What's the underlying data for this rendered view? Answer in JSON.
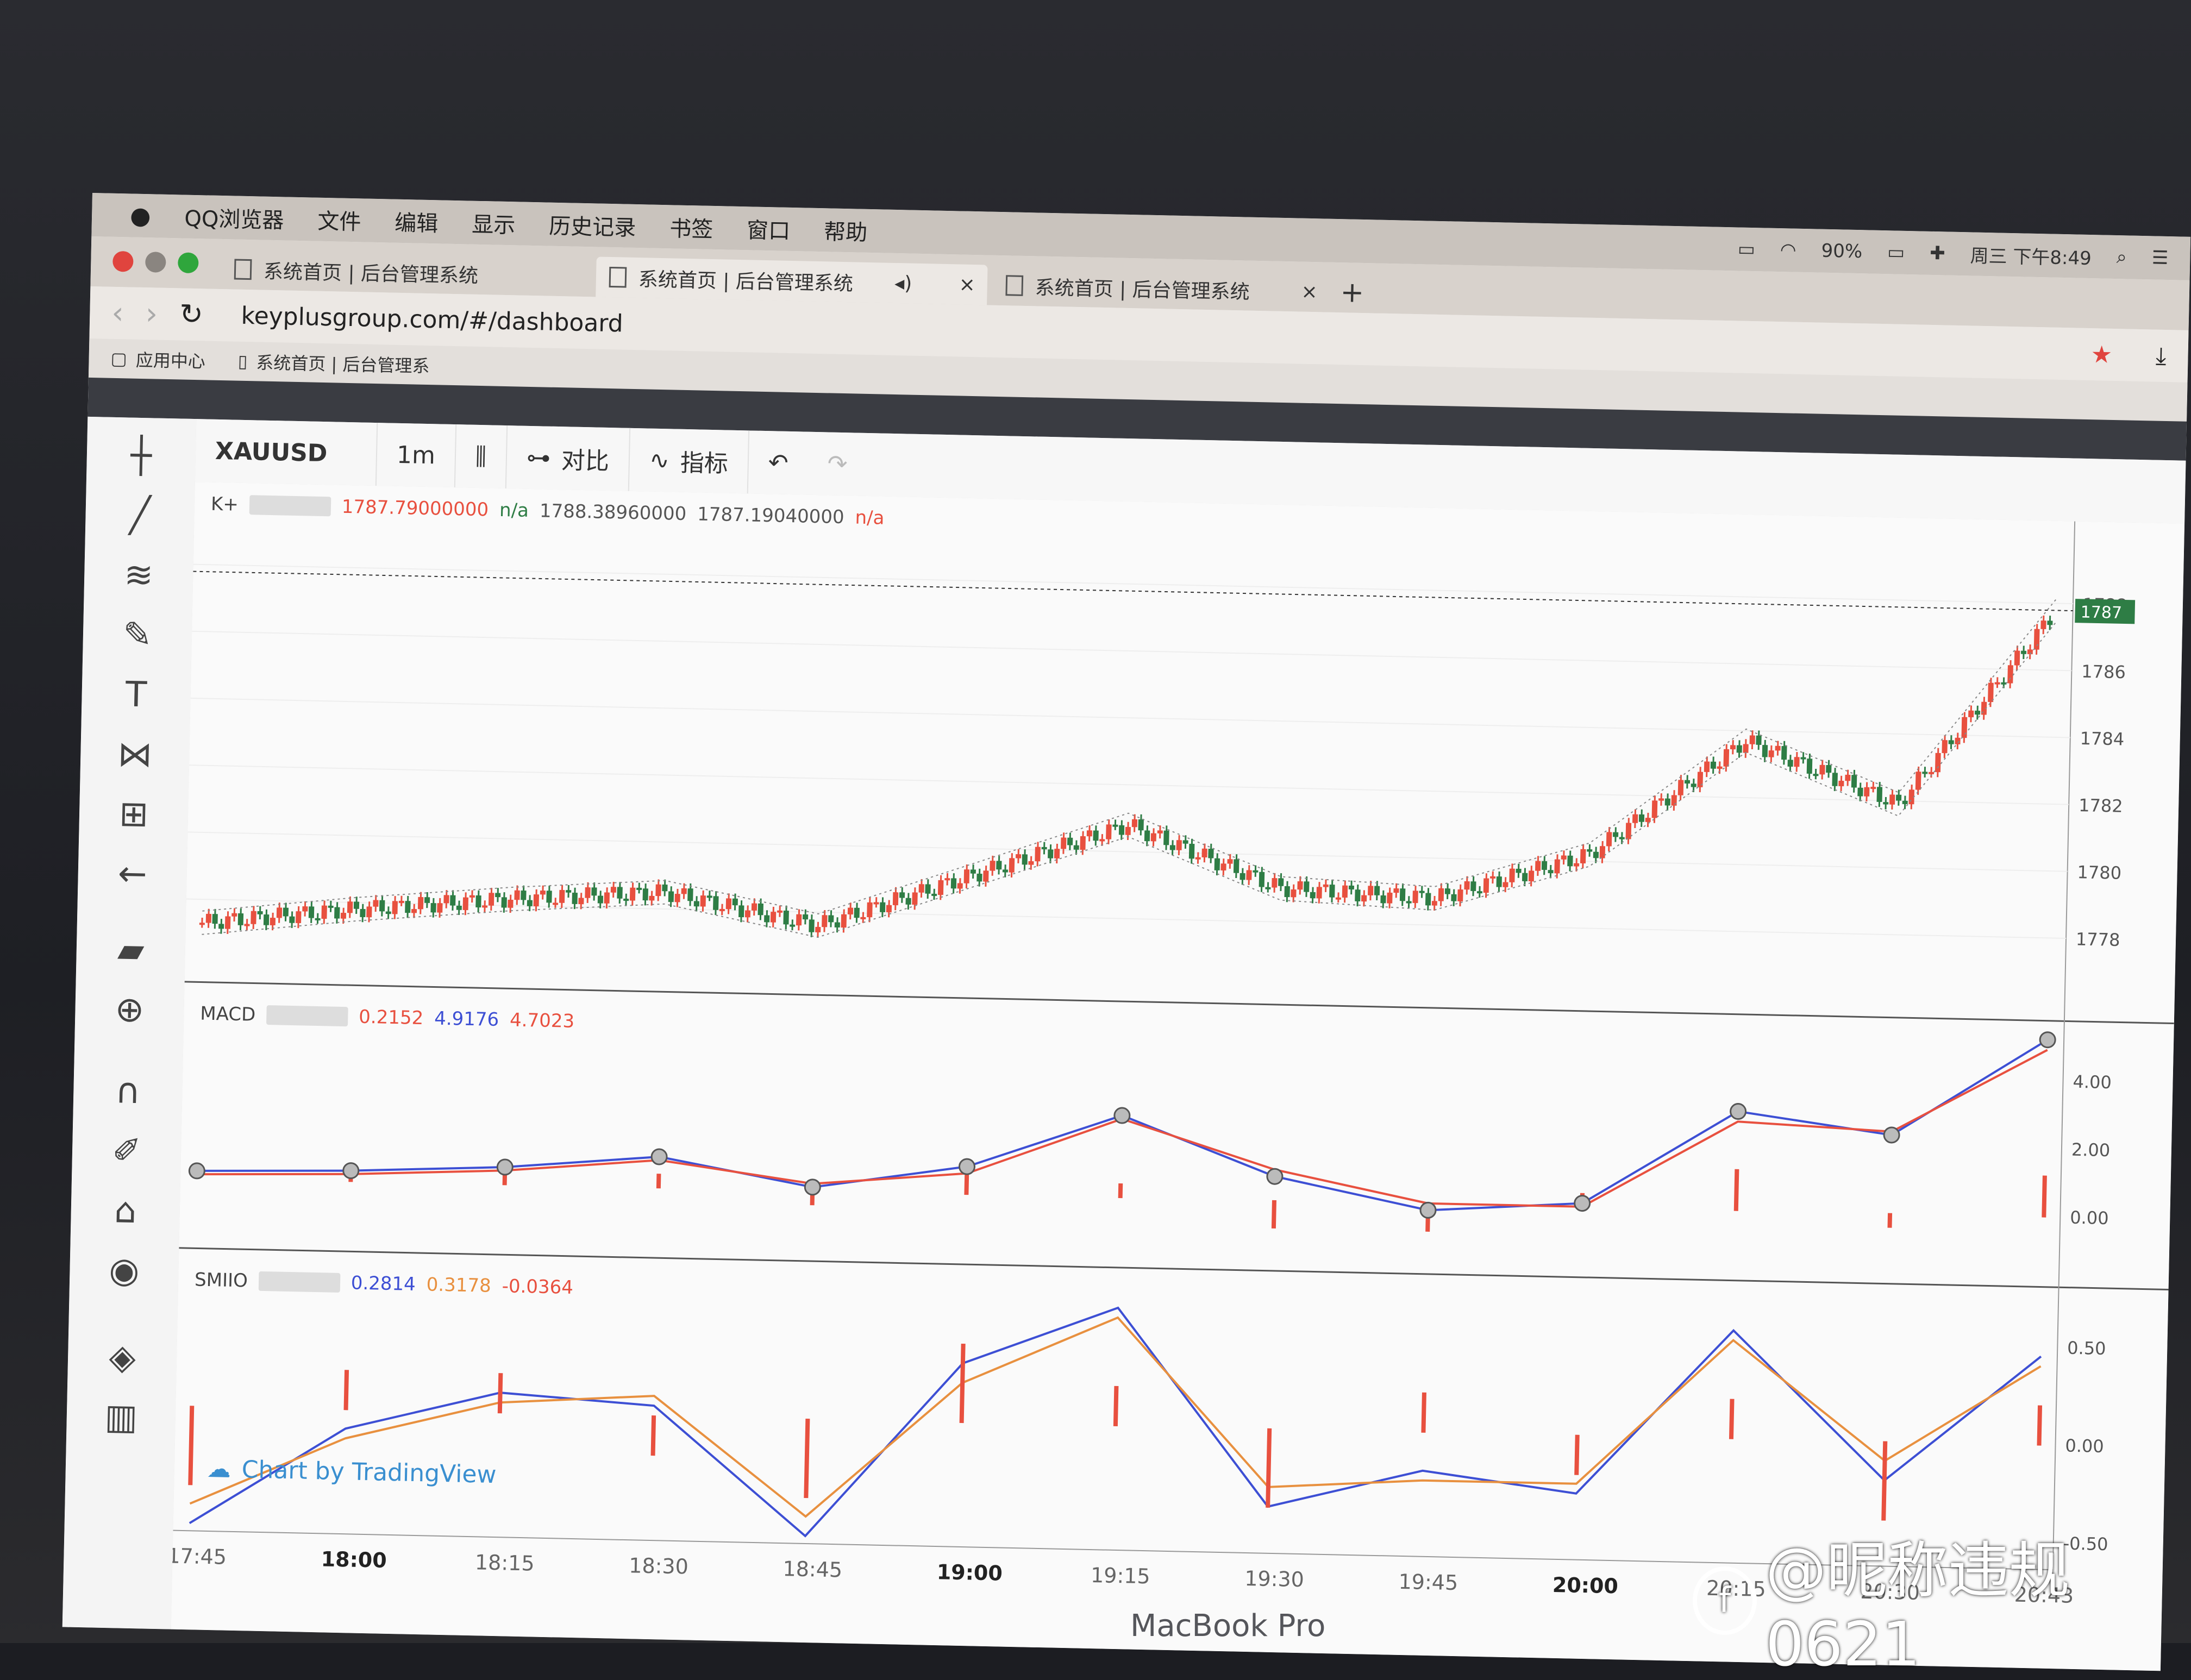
{
  "menubar": {
    "app": "QQ浏览器",
    "items": [
      "文件",
      "编辑",
      "显示",
      "历史记录",
      "书签",
      "窗口",
      "帮助"
    ],
    "battery": "90%",
    "clock": "周三 下午8:49"
  },
  "tabs": [
    {
      "title": "系统首页 | 后台管理系统"
    },
    {
      "title": "系统首页 | 后台管理系统"
    },
    {
      "title": "系统首页 | 后台管理系统"
    }
  ],
  "address": {
    "url": "keyplusgroup.com/#/dashboard"
  },
  "bookmarks": {
    "apps": "应用中心",
    "page": "系统首页 | 后台管理系"
  },
  "toolbar": {
    "symbol": "XAUUSD",
    "interval": "1m",
    "compare": "对比",
    "indicators": "指标"
  },
  "legends": {
    "main": {
      "name": "K+",
      "v1": "1787.79000000",
      "v2": "n/a",
      "v3": "1788.38960000",
      "v4": "1787.19040000",
      "v5": "n/a"
    },
    "macd": {
      "name": "MACD",
      "v1": "0.2152",
      "v2": "4.9176",
      "v3": "4.7023"
    },
    "smio": {
      "name": "SMIIO",
      "v1": "0.2814",
      "v2": "0.3178",
      "v3": "-0.0364"
    }
  },
  "attribution": "Chart by TradingView",
  "colors": {
    "up": "#e8503f",
    "down": "#2e7d45",
    "macd_line": "#3d4fd4",
    "signal_line": "#e8503f"
  },
  "chart_data": [
    {
      "type": "candlestick",
      "name": "K+",
      "x": [
        "17:45",
        "18:00",
        "18:15",
        "18:30",
        "18:45",
        "19:00",
        "19:15",
        "19:30",
        "19:45",
        "20:00",
        "20:15",
        "20:30",
        "20:43"
      ],
      "y": [
        1777.3,
        1777.8,
        1778.2,
        1778.5,
        1777.6,
        1779.2,
        1780.8,
        1779.0,
        1778.8,
        1780.2,
        1783.7,
        1781.9,
        1787.8
      ],
      "yticks": [
        "1788",
        "1786",
        "1784",
        "1782",
        "1780",
        "1778"
      ],
      "last_price": "1787"
    },
    {
      "type": "line",
      "name": "MACD",
      "x": [
        "17:45",
        "18:00",
        "18:15",
        "18:30",
        "18:45",
        "19:00",
        "19:15",
        "19:30",
        "19:45",
        "20:00",
        "20:15",
        "20:30",
        "20:43"
      ],
      "series": [
        {
          "values": [
            0.2,
            0.3,
            0.5,
            0.9,
            0.1,
            0.8,
            2.4,
            0.7,
            -0.2,
            0.1,
            2.9,
            2.3,
            5.2
          ]
        },
        {
          "values": [
            0.1,
            0.2,
            0.4,
            0.8,
            0.2,
            0.6,
            2.3,
            0.9,
            0.0,
            0.0,
            2.6,
            2.4,
            4.9
          ]
        }
      ],
      "yticks": [
        "4.00",
        "2.00",
        "0.00"
      ]
    },
    {
      "type": "line",
      "name": "SMIIO",
      "x": [
        "17:45",
        "18:00",
        "18:15",
        "18:30",
        "18:45",
        "19:00",
        "19:15",
        "19:30",
        "19:45",
        "20:00",
        "20:15",
        "20:30",
        "20:43"
      ],
      "series": [
        {
          "values": [
            -0.6,
            -0.1,
            0.1,
            0.05,
            -0.6,
            0.3,
            0.6,
            -0.4,
            -0.2,
            -0.3,
            0.55,
            -0.2,
            0.45
          ]
        },
        {
          "values": [
            -0.5,
            -0.15,
            0.05,
            0.1,
            -0.5,
            0.2,
            0.55,
            -0.3,
            -0.25,
            -0.25,
            0.5,
            -0.1,
            0.4
          ]
        }
      ],
      "yticks": [
        "0.50",
        "0.00",
        "-0.50"
      ]
    }
  ],
  "xaxis": [
    "17:45",
    "18:00",
    "18:15",
    "18:30",
    "18:45",
    "19:00",
    "19:15",
    "19:30",
    "19:45",
    "20:00",
    "20:15",
    "20:30",
    "20:43"
  ],
  "watermark": "@昵称违规0621",
  "device": "MacBook Pro"
}
